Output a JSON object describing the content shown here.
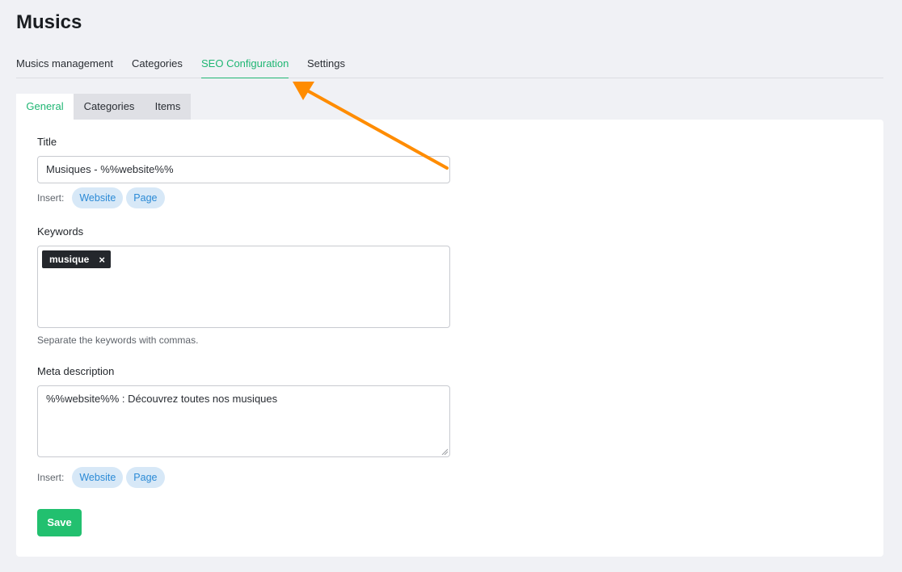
{
  "page": {
    "title": "Musics"
  },
  "main_tabs": [
    {
      "label": "Musics management",
      "active": false
    },
    {
      "label": "Categories",
      "active": false
    },
    {
      "label": "SEO Configuration",
      "active": true
    },
    {
      "label": "Settings",
      "active": false
    }
  ],
  "sub_tabs": [
    {
      "label": "General",
      "active": true
    },
    {
      "label": "Categories",
      "active": false
    },
    {
      "label": "Items",
      "active": false
    }
  ],
  "form": {
    "title": {
      "label": "Title",
      "value": "Musiques - %%website%%",
      "insert_label": "Insert:",
      "insert_options": [
        "Website",
        "Page"
      ]
    },
    "keywords": {
      "label": "Keywords",
      "tags": [
        "musique"
      ],
      "remove_symbol": "×",
      "help": "Separate the keywords with commas."
    },
    "meta_description": {
      "label": "Meta description",
      "value": "%%website%% : Découvrez toutes nos musiques",
      "insert_label": "Insert:",
      "insert_options": [
        "Website",
        "Page"
      ]
    },
    "save_label": "Save"
  },
  "colors": {
    "accent": "#1fb673",
    "save_button": "#22c06f",
    "pill_bg": "#d7e8f7",
    "pill_text": "#2b8ad6",
    "annotation_arrow": "#ff8c00"
  },
  "annotation": {
    "type": "arrow",
    "points_to": "SEO Configuration"
  }
}
